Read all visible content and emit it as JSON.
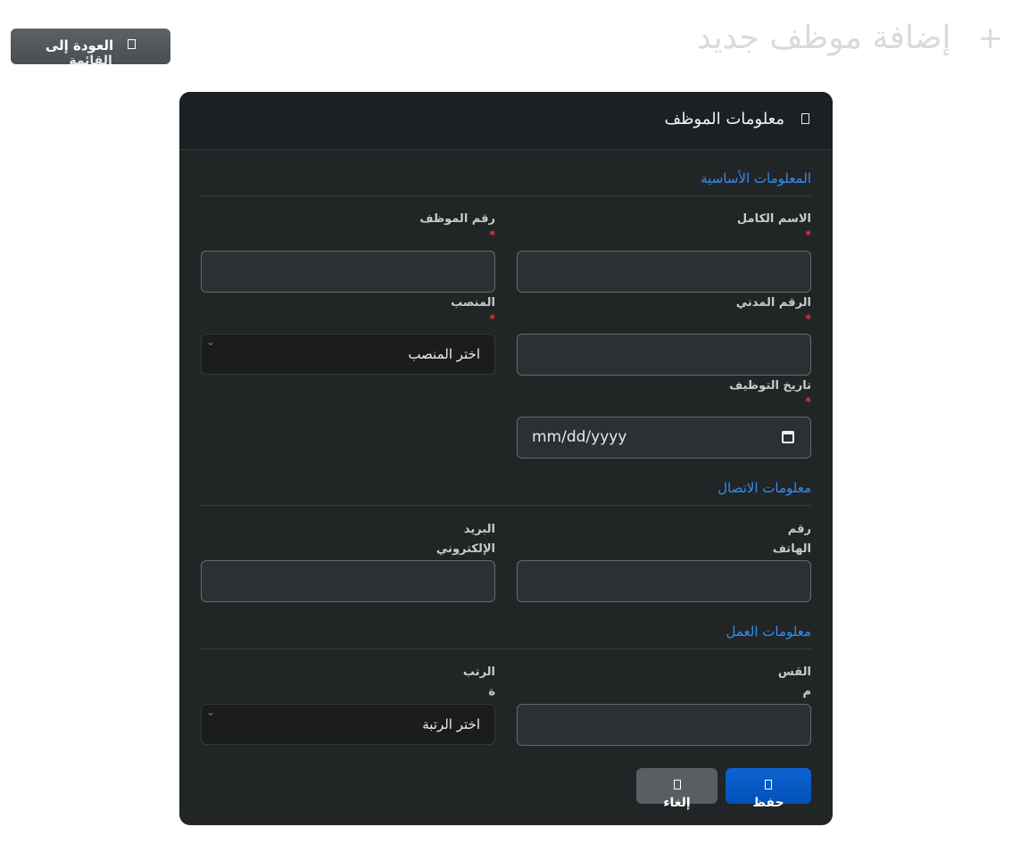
{
  "header": {
    "title": "إضافة موظف جديد",
    "add_icon": "plus-icon",
    "back_label_line1": "العودة إلى",
    "back_label_line2": "القائمة",
    "back_icon": "arrow-icon"
  },
  "card": {
    "title": "معلومات الموظف",
    "title_icon": "user-card-icon",
    "sections": {
      "basic": "المعلومات الأساسية",
      "contact": "معلومات الاتصال",
      "work": "معلومات العمل"
    },
    "fields": {
      "full_name_label": "الاسم الكامل",
      "employee_number_label": "رقم الموظف",
      "civil_id_label": "الرقم المدني",
      "position_label": "المنصب",
      "position_value": "اختر المنصب",
      "hire_date_label": "تاريخ التوظيف",
      "hire_date_placeholder": "mm/dd/yyyy",
      "phone_label_1": "رقم",
      "phone_label_2": "الهاتف",
      "email_label_1": "البريد",
      "email_label_2": "الإلكتروني",
      "department_label_1": "القس",
      "department_label_2": "م",
      "rank_label_1": "الرتب",
      "rank_label_2": "ة",
      "rank_value": "اختر الرتبة",
      "required_mark": "*"
    },
    "buttons": {
      "save": "حفظ",
      "cancel": "إلغاء"
    }
  },
  "colors": {
    "accent": "#2f8ff0",
    "required": "#dc3545",
    "card_bg": "#222526",
    "save": "#0b63d1"
  }
}
